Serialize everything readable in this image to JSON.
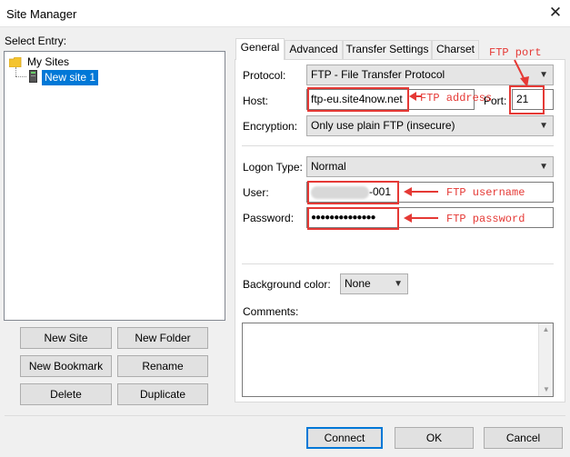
{
  "window": {
    "title": "Site Manager",
    "close_glyph": "✕"
  },
  "left": {
    "select_entry_label": "Select Entry:",
    "tree": {
      "root": "My Sites",
      "child": "New site 1"
    },
    "buttons": {
      "new_site": "New Site",
      "new_folder": "New Folder",
      "new_bookmark": "New Bookmark",
      "rename": "Rename",
      "delete": "Delete",
      "duplicate": "Duplicate"
    }
  },
  "tabs": [
    "General",
    "Advanced",
    "Transfer Settings",
    "Charset"
  ],
  "general": {
    "protocol_label": "Protocol:",
    "protocol_value": "FTP - File Transfer Protocol",
    "host_label": "Host:",
    "host_value": "ftp-eu.site4now.net",
    "port_label": "Port:",
    "port_value": "21",
    "encryption_label": "Encryption:",
    "encryption_value": "Only use plain FTP (insecure)",
    "logon_type_label": "Logon Type:",
    "logon_type_value": "Normal",
    "user_label": "User:",
    "user_value": "-001",
    "password_label": "Password:",
    "password_value": "●●●●●●●●●●●●●●",
    "background_color_label": "Background color:",
    "background_color_value": "None",
    "comments_label": "Comments:"
  },
  "annotations": {
    "ftp_port": "FTP port",
    "ftp_address": "FTP address",
    "ftp_username": "FTP username",
    "ftp_password": "FTP password"
  },
  "footer": {
    "connect": "Connect",
    "ok": "OK",
    "cancel": "Cancel"
  },
  "colors": {
    "selection": "#0078d7",
    "annotation": "#e53935",
    "folder": "#f4c430"
  }
}
